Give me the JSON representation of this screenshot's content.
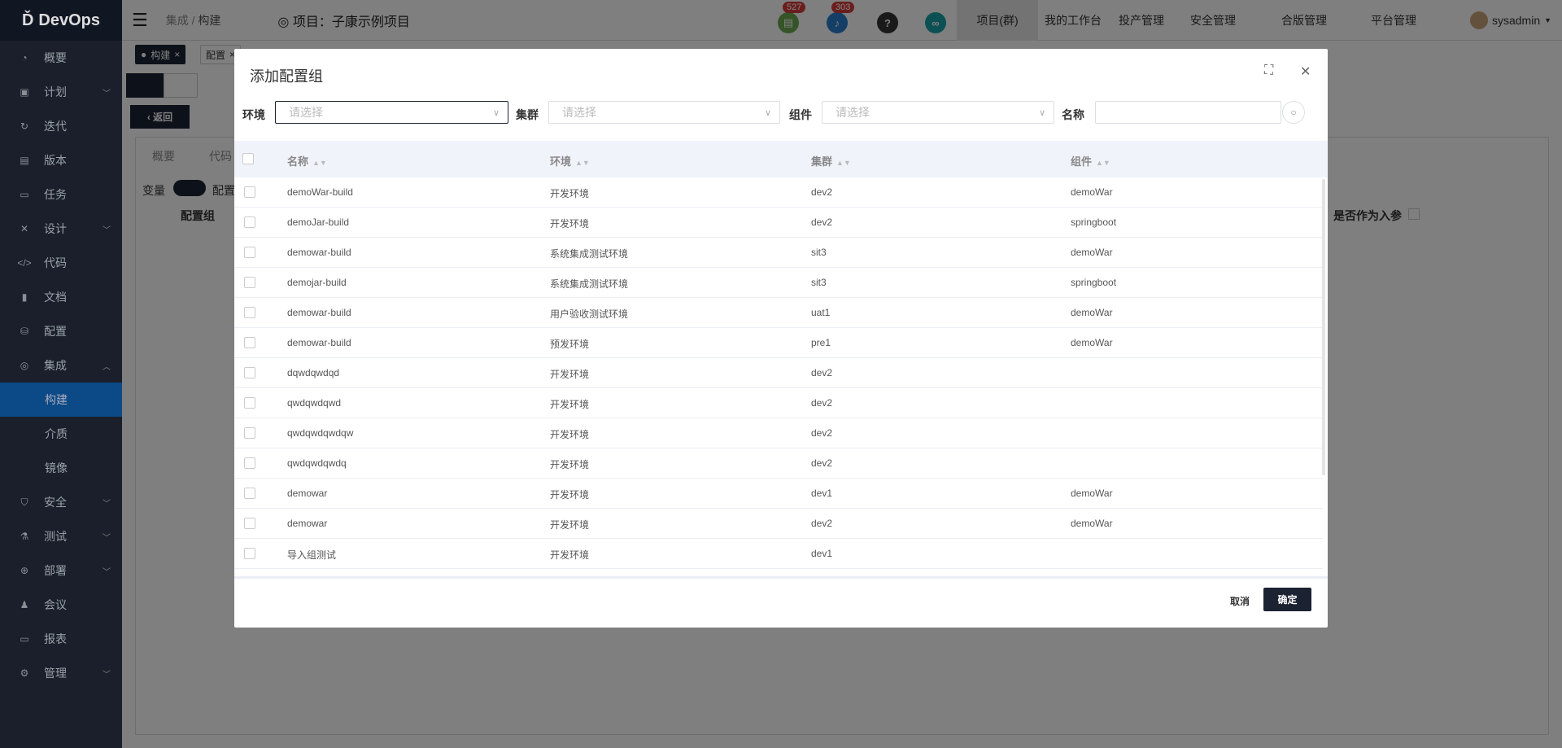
{
  "app": {
    "logo": "DevOps"
  },
  "header": {
    "breadcrumb": [
      "集成",
      "构建"
    ],
    "project": "项目：子康示例项目",
    "badges": {
      "docs": "527",
      "bell": "303"
    },
    "nav": [
      "项目(群)",
      "我的工作台",
      "投产管理",
      "安全管理",
      "合版管理",
      "平台管理"
    ],
    "user": "sysadmin"
  },
  "sidebar": [
    {
      "label": "概要",
      "icon": "dashboard-icon"
    },
    {
      "label": "计划",
      "icon": "plan-icon",
      "chev": "down"
    },
    {
      "label": "迭代",
      "icon": "iteration-icon"
    },
    {
      "label": "版本",
      "icon": "version-icon"
    },
    {
      "label": "任务",
      "icon": "task-icon"
    },
    {
      "label": "设计",
      "icon": "design-icon",
      "chev": "down"
    },
    {
      "label": "代码",
      "icon": "code-icon"
    },
    {
      "label": "文档",
      "icon": "document-icon"
    },
    {
      "label": "配置",
      "icon": "config-icon"
    },
    {
      "label": "集成",
      "icon": "integration-icon",
      "chev": "up"
    },
    {
      "label": "构建",
      "sub": true,
      "active": true
    },
    {
      "label": "介质",
      "sub": true
    },
    {
      "label": "镜像",
      "sub": true
    },
    {
      "label": "安全",
      "icon": "shield-icon",
      "chev": "down"
    },
    {
      "label": "测试",
      "icon": "flask-icon",
      "chev": "down"
    },
    {
      "label": "部署",
      "icon": "deploy-icon",
      "chev": "down"
    },
    {
      "label": "会议",
      "icon": "meeting-icon"
    },
    {
      "label": "报表",
      "icon": "report-icon"
    },
    {
      "label": "管理",
      "icon": "gear-icon",
      "chev": "down"
    }
  ],
  "page": {
    "tabs": [
      "构建",
      "配置"
    ],
    "back": "返回",
    "subtabs": [
      "概要",
      "代码"
    ],
    "toggle_label": "变量",
    "toggle_after": "配置",
    "config_group_label": "配置组",
    "param_label": "是否作为入参"
  },
  "dialog": {
    "title": "添加配置组",
    "filters": {
      "env_label": "环境",
      "cluster_label": "集群",
      "component_label": "组件",
      "name_label": "名称",
      "placeholder": "请选择"
    },
    "columns": [
      "名称",
      "环境",
      "集群",
      "组件"
    ],
    "rows": [
      [
        "demoWar-build",
        "开发环境",
        "dev2",
        "demoWar"
      ],
      [
        "demoJar-build",
        "开发环境",
        "dev2",
        "springboot"
      ],
      [
        "demowar-build",
        "系统集成测试环境",
        "sit3",
        "demoWar"
      ],
      [
        "demojar-build",
        "系统集成测试环境",
        "sit3",
        "springboot"
      ],
      [
        "demowar-build",
        "用户验收测试环境",
        "uat1",
        "demoWar"
      ],
      [
        "demowar-build",
        "预发环境",
        "pre1",
        "demoWar"
      ],
      [
        "dqwdqwdqd",
        "开发环境",
        "dev2",
        ""
      ],
      [
        "qwdqwdqwd",
        "开发环境",
        "dev2",
        ""
      ],
      [
        "qwdqwdqwdqw",
        "开发环境",
        "dev2",
        ""
      ],
      [
        "qwdqwdqwdq",
        "开发环境",
        "dev2",
        ""
      ],
      [
        "demowar",
        "开发环境",
        "dev1",
        "demoWar"
      ],
      [
        "demowar",
        "开发环境",
        "dev2",
        "demoWar"
      ],
      [
        "导入组测试",
        "开发环境",
        "dev1",
        ""
      ]
    ],
    "cancel": "取消",
    "confirm": "确定"
  }
}
